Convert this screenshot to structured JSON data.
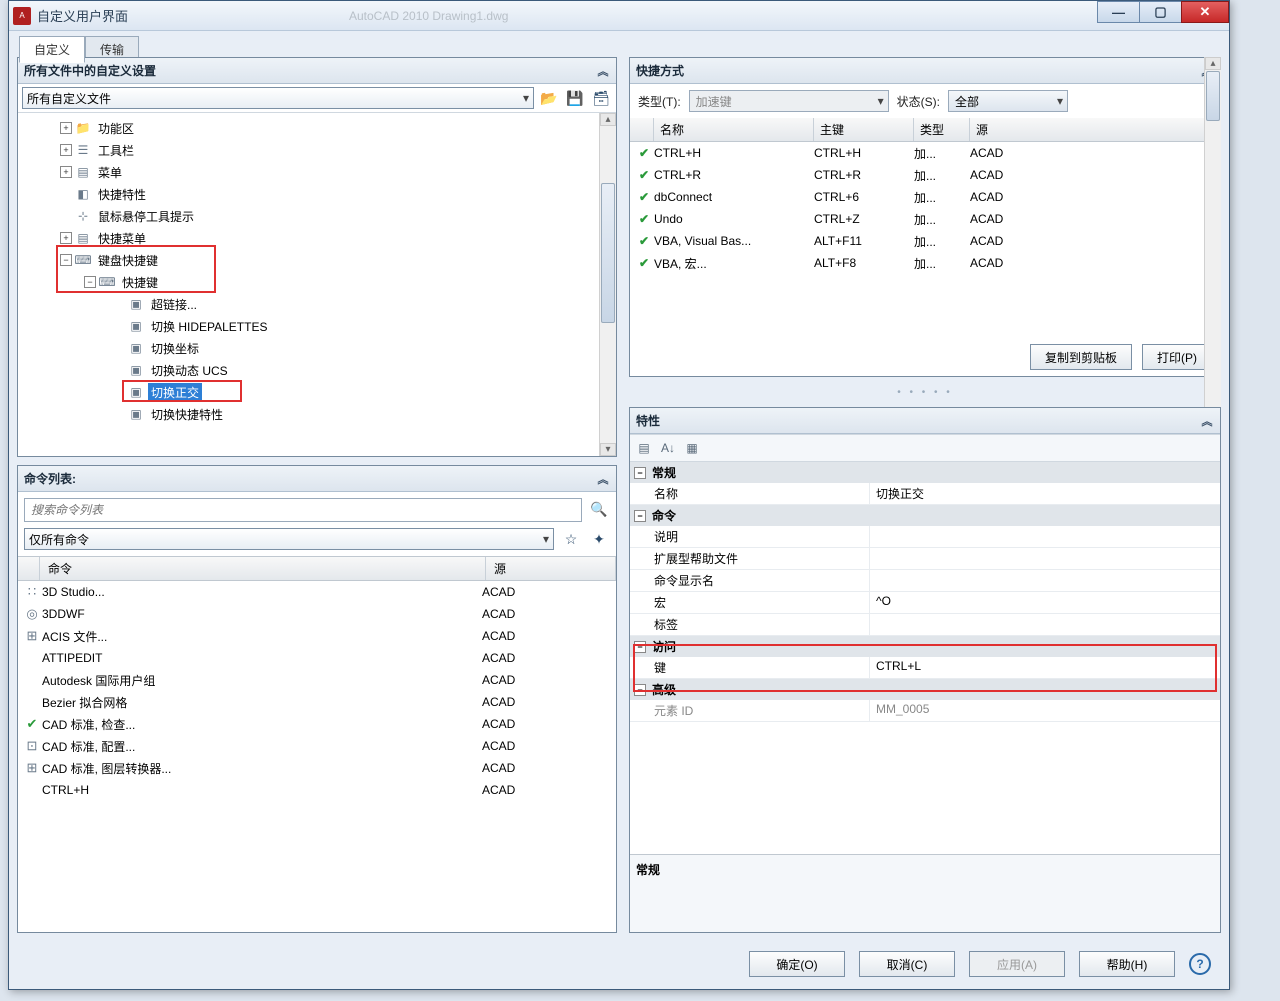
{
  "titlebar": {
    "title": "自定义用户界面",
    "faded": "AutoCAD 2010        Drawing1.dwg"
  },
  "tabs": {
    "customize": "自定义",
    "transfer": "传输"
  },
  "left": {
    "panel1_title": "所有文件中的自定义设置",
    "file_select": "所有自定义文件",
    "tree": {
      "n1": "功能区",
      "n2": "工具栏",
      "n3": "菜单",
      "n4": "快捷特性",
      "n5": "鼠标悬停工具提示",
      "n6": "快捷菜单",
      "n7": "键盘快捷键",
      "n8": "快捷键",
      "n9": "超链接...",
      "n10": "切换 HIDEPALETTES",
      "n11": "切换坐标",
      "n12": "切换动态 UCS",
      "n13": "切换正交",
      "n14": "切换快捷特性"
    },
    "cmdlist_title": "命令列表:",
    "search_placeholder": "搜索命令列表",
    "filter_select": "仅所有命令",
    "cmd_hdr": {
      "c1": "命令",
      "c2": "源"
    },
    "cmds": [
      {
        "icon": "∷",
        "name": "3D Studio...",
        "src": "ACAD"
      },
      {
        "icon": "◎",
        "name": "3DDWF",
        "src": "ACAD"
      },
      {
        "icon": "⊞",
        "name": "ACIS 文件...",
        "src": "ACAD"
      },
      {
        "icon": "",
        "name": "ATTIPEDIT",
        "src": "ACAD"
      },
      {
        "icon": "",
        "name": "Autodesk 国际用户组",
        "src": "ACAD"
      },
      {
        "icon": "",
        "name": "Bezier 拟合网格",
        "src": "ACAD"
      },
      {
        "icon": "✔",
        "name": "CAD 标准, 检查...",
        "src": "ACAD",
        "chk": true
      },
      {
        "icon": "⊡",
        "name": "CAD 标准, 配置...",
        "src": "ACAD"
      },
      {
        "icon": "⊞",
        "name": "CAD 标准, 图层转换器...",
        "src": "ACAD"
      },
      {
        "icon": "",
        "name": "CTRL+H",
        "src": "ACAD"
      }
    ]
  },
  "right": {
    "shortcut_title": "快捷方式",
    "type_lbl": "类型(T):",
    "type_val": "加速键",
    "state_lbl": "状态(S):",
    "state_val": "全部",
    "list_hdr": {
      "h1": "名称",
      "h2": "主键",
      "h3": "类型",
      "h4": "源"
    },
    "list": [
      {
        "n": "CTRL+H",
        "k": "CTRL+H",
        "t": "加...",
        "s": "ACAD"
      },
      {
        "n": "CTRL+R",
        "k": "CTRL+R",
        "t": "加...",
        "s": "ACAD"
      },
      {
        "n": "dbConnect",
        "k": "CTRL+6",
        "t": "加...",
        "s": "ACAD"
      },
      {
        "n": "Undo",
        "k": "CTRL+Z",
        "t": "加...",
        "s": "ACAD"
      },
      {
        "n": "VBA, Visual Bas...",
        "k": "ALT+F11",
        "t": "加...",
        "s": "ACAD"
      },
      {
        "n": "VBA, 宏...",
        "k": "ALT+F8",
        "t": "加...",
        "s": "ACAD"
      }
    ],
    "copy_btn": "复制到剪贴板",
    "print_btn": "打印(P)",
    "props_title": "特性",
    "cat_general": "常规",
    "p_name_k": "名称",
    "p_name_v": "切换正交",
    "cat_cmd": "命令",
    "p_desc": "说明",
    "p_ext": "扩展型帮助文件",
    "p_disp": "命令显示名",
    "p_macro_k": "宏",
    "p_macro_v": "^O",
    "p_tag": "标签",
    "cat_access": "访问",
    "p_key_k": "键",
    "p_key_v": "CTRL+L",
    "cat_adv": "高级",
    "p_elem_k": "元素 ID",
    "p_elem_v": "MM_0005",
    "desc_title": "常规"
  },
  "bottom": {
    "ok": "确定(O)",
    "cancel": "取消(C)",
    "apply": "应用(A)",
    "help": "帮助(H)"
  }
}
